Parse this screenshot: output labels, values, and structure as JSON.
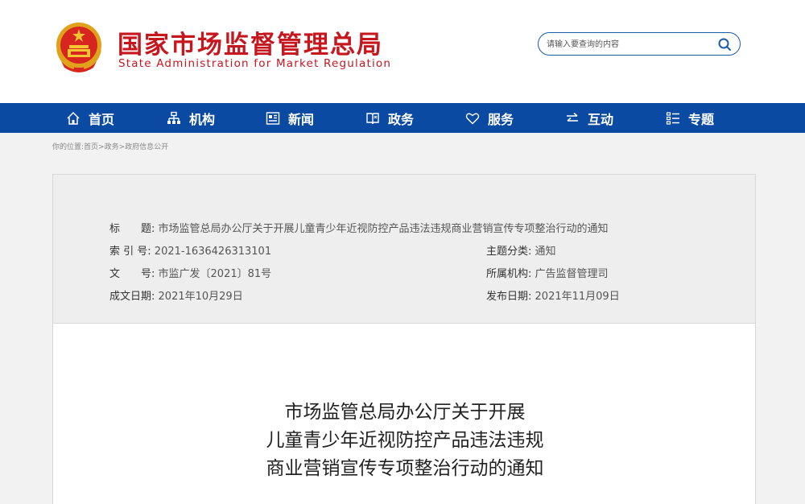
{
  "header": {
    "title_cn": "国家市场监督管理总局",
    "title_en": "State Administration for Market Regulation",
    "emblem_icon": "national-emblem-icon",
    "search": {
      "placeholder": "请输入要查询的内容",
      "icon": "search-icon"
    }
  },
  "nav": {
    "items": [
      {
        "label": "首页",
        "icon": "home-icon"
      },
      {
        "label": "机构",
        "icon": "org-chart-icon"
      },
      {
        "label": "新闻",
        "icon": "news-icon"
      },
      {
        "label": "政务",
        "icon": "book-icon"
      },
      {
        "label": "服务",
        "icon": "heart-icon"
      },
      {
        "label": "互动",
        "icon": "exchange-icon"
      },
      {
        "label": "专题",
        "icon": "list-icon"
      }
    ]
  },
  "breadcrumb": "你的位置:首页>政务>政府信息公开",
  "meta": {
    "title_label": "标　　题:",
    "title_value": "市场监管总局办公厅关于开展儿童青少年近视防控产品违法违规商业营销宣传专项整治行动的通知",
    "index_label": "索 引 号:",
    "index_value": "2021-1636426313101",
    "topic_label": "主题分类:",
    "topic_value": "通知",
    "docno_label": "文　　号:",
    "docno_value": "市监广发〔2021〕81号",
    "dept_label": "所属机构:",
    "dept_value": "广告监督管理司",
    "created_label": "成文日期:",
    "created_value": "2021年10月29日",
    "published_label": "发布日期:",
    "published_value": "2021年11月09日"
  },
  "document": {
    "title_lines": [
      "市场监管总局办公厅关于开展",
      "儿童青少年近视防控产品违法违规",
      "商业营销宣传专项整治行动的通知"
    ]
  },
  "colors": {
    "brand_red": "#c6161e",
    "nav_blue": "#0b4aa2"
  }
}
